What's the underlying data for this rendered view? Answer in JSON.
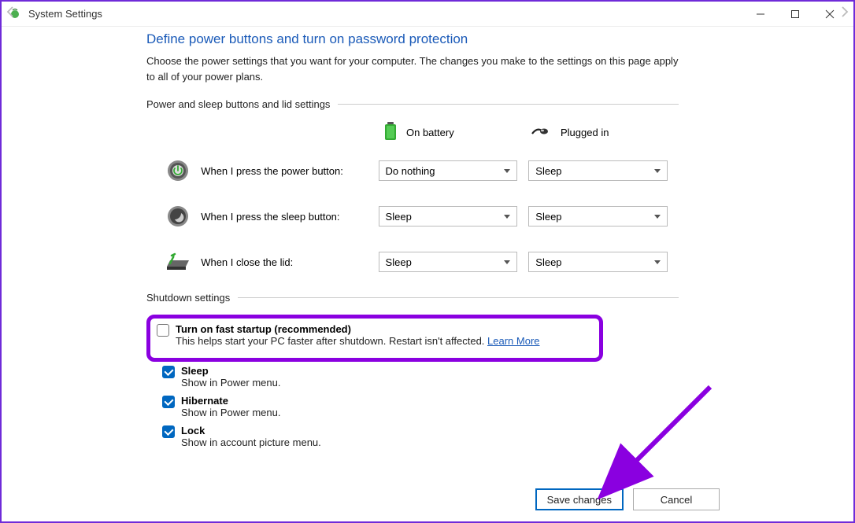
{
  "window": {
    "title": "System Settings"
  },
  "page": {
    "heading": "Define power buttons and turn on password protection",
    "description": "Choose the power settings that you want for your computer. The changes you make to the settings on this page apply to all of your power plans."
  },
  "sections": {
    "power_sleep": "Power and sleep buttons and lid settings",
    "shutdown": "Shutdown settings"
  },
  "columns": {
    "battery": "On battery",
    "plugged": "Plugged in"
  },
  "rows": {
    "power": {
      "label": "When I press the power button:",
      "battery": "Do nothing",
      "plugged": "Sleep"
    },
    "sleep": {
      "label": "When I press the sleep button:",
      "battery": "Sleep",
      "plugged": "Sleep"
    },
    "lid": {
      "label": "When I close the lid:",
      "battery": "Sleep",
      "plugged": "Sleep"
    }
  },
  "shutdown_settings": {
    "fast_startup": {
      "title": "Turn on fast startup (recommended)",
      "desc": "This helps start your PC faster after shutdown. Restart isn't affected. ",
      "link": "Learn More"
    },
    "sleep": {
      "title": "Sleep",
      "desc": "Show in Power menu."
    },
    "hibernate": {
      "title": "Hibernate",
      "desc": "Show in Power menu."
    },
    "lock": {
      "title": "Lock",
      "desc": "Show in account picture menu."
    }
  },
  "buttons": {
    "save": "Save changes",
    "cancel": "Cancel"
  }
}
